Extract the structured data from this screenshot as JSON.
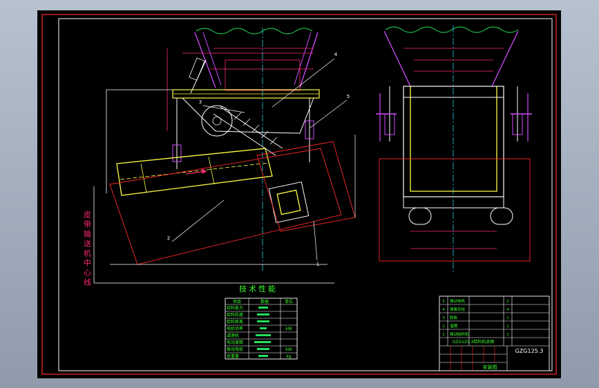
{
  "drawing": {
    "side_text": "皮带输送机中心线",
    "spec_table": {
      "title": "技术性能",
      "headers": [
        "项目",
        "数据",
        "单位"
      ],
      "rows": [
        [
          "给料能力",
          "",
          ""
        ],
        [
          "给料粒度",
          "",
          ""
        ],
        [
          "给料距离",
          "",
          ""
        ],
        [
          "电机功率",
          "",
          "kW"
        ],
        [
          "减速机",
          "",
          ""
        ],
        [
          "电动滚筒",
          "",
          ""
        ],
        [
          "振动电机",
          "",
          "kW"
        ],
        [
          "总重量",
          "",
          "kg"
        ]
      ]
    },
    "title_block": {
      "drawing_no": "GZG125.3",
      "product_name": "GZG125.3给料机总图",
      "view_name": "安装图",
      "rows": [
        [
          "1",
          "振动给料机",
          "",
          "1",
          ""
        ],
        [
          "2",
          "溜槽",
          "",
          "1",
          ""
        ],
        [
          "3",
          "胶板",
          "",
          "1",
          ""
        ],
        [
          "4",
          "弹簧吊挂",
          "",
          "4",
          ""
        ],
        [
          "5",
          "振动电机",
          "",
          "2",
          ""
        ]
      ]
    },
    "balloons": [
      "1",
      "2",
      "3",
      "4",
      "5"
    ],
    "colors": {
      "outline": "#ffffff",
      "equipment": "#ffff44",
      "dimensions": "#ff2a6d",
      "annotations": "#39ff2a",
      "centerline": "#22d3e8",
      "hopper": "#d14cff",
      "material": "#22e05a"
    }
  }
}
